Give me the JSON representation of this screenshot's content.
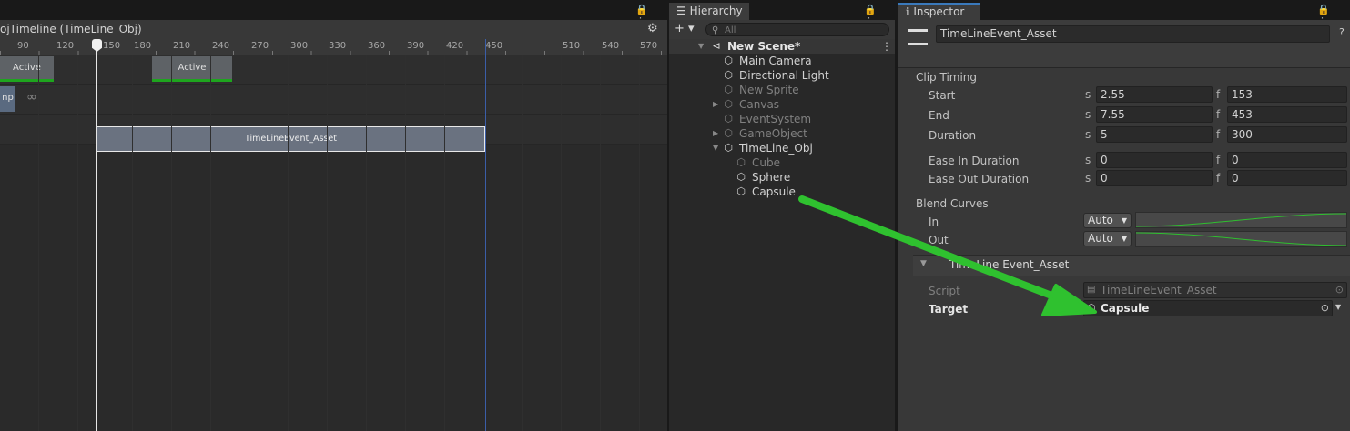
{
  "timeline": {
    "tab_icons": "🔒 ⋮",
    "title": "ojTimeline (TimeLine_Obj)",
    "gear": "⚙",
    "ruler_ticks": [
      "90",
      "120",
      "150",
      "180",
      "210",
      "240",
      "270",
      "300",
      "330",
      "360",
      "390",
      "420",
      "450",
      "510",
      "540",
      "570"
    ],
    "clips": {
      "active_1": "Active",
      "active_2": "Active",
      "clip_partial": "np",
      "loop_icon": "∞",
      "event": "TimeLineEvent_Asset"
    }
  },
  "hierarchy": {
    "tab_label": "Hierarchy",
    "tab_glyph": "☰",
    "tab_icons": "🔒 ⋮",
    "add_label": "+ ▾",
    "search_placeholder": "All",
    "scene_name": "New Scene*",
    "items": [
      {
        "label": "Main Camera"
      },
      {
        "label": "Directional Light"
      },
      {
        "label": "New Sprite"
      },
      {
        "label": "Canvas"
      },
      {
        "label": "EventSystem"
      },
      {
        "label": "GameObject"
      },
      {
        "label": "TimeLine_Obj"
      },
      {
        "label": "Cube"
      },
      {
        "label": "Sphere"
      },
      {
        "label": "Capsule"
      }
    ]
  },
  "inspector": {
    "tab_label": "Inspector",
    "tab_glyph": "ℹ",
    "tab_icons": "🔒 ⋮",
    "object_name": "TimeLineEvent_Asset",
    "help": "?",
    "clip_timing_title": "Clip Timing",
    "unit_s": "s",
    "unit_f": "f",
    "rows": [
      {
        "label": "Start",
        "s": "2.55",
        "f": "153"
      },
      {
        "label": "End",
        "s": "7.55",
        "f": "453"
      },
      {
        "label": "Duration",
        "s": "5",
        "f": "300"
      },
      {
        "label": "Ease In Duration",
        "s": "0",
        "f": "0"
      },
      {
        "label": "Ease Out Duration",
        "s": "0",
        "f": "0"
      }
    ],
    "blend_curves_title": "Blend Curves",
    "blend_in_label": "In",
    "blend_out_label": "Out",
    "blend_in_value": "Auto",
    "blend_out_value": "Auto",
    "component_title": "TimeLine Event_Asset",
    "script_label": "Script",
    "script_value": "TimeLineEvent_Asset",
    "target_label": "Target",
    "target_value": "Capsule"
  },
  "colors": {
    "accent_blue": "#3a79bb",
    "active_green": "#1ea51e",
    "annotation_arrow": "#2fc12f"
  }
}
